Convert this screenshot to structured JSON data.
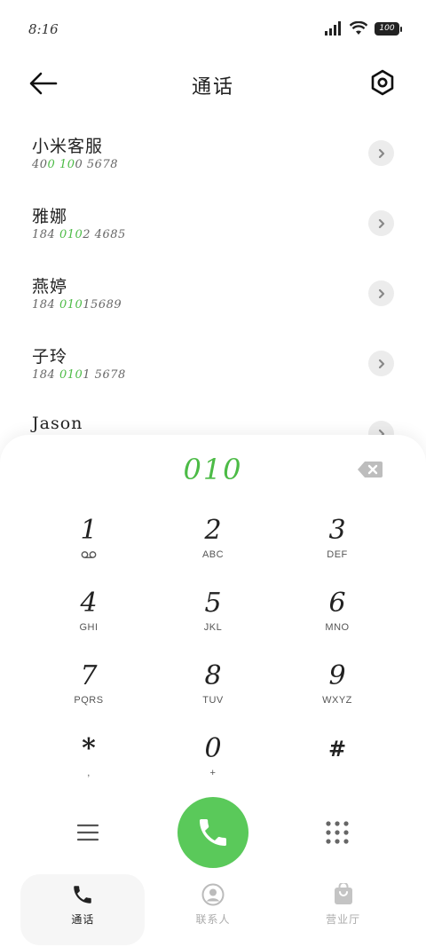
{
  "status_bar": {
    "time": "8:16",
    "battery": "100"
  },
  "header": {
    "title": "通话"
  },
  "contacts": [
    {
      "name": "小米客服",
      "number_pre": "40",
      "number_hl": "0 10",
      "number_post": "0 5678"
    },
    {
      "name": "雅娜",
      "number_pre": "184 ",
      "number_hl": "010",
      "number_post": "2 4685"
    },
    {
      "name": "燕婷",
      "number_pre": "184 ",
      "number_hl": "010",
      "number_post": "15689"
    },
    {
      "name": "子玲",
      "number_pre": "184 ",
      "number_hl": "010",
      "number_post": "1 5678"
    },
    {
      "name": "Jason",
      "number_pre": "",
      "number_hl": "",
      "number_post": ""
    }
  ],
  "dialer": {
    "input": "010",
    "keys": [
      {
        "digit": "1",
        "sub": ""
      },
      {
        "digit": "2",
        "sub": "ABC"
      },
      {
        "digit": "3",
        "sub": "DEF"
      },
      {
        "digit": "4",
        "sub": "GHI"
      },
      {
        "digit": "5",
        "sub": "JKL"
      },
      {
        "digit": "6",
        "sub": "MNO"
      },
      {
        "digit": "7",
        "sub": "PQRS"
      },
      {
        "digit": "8",
        "sub": "TUV"
      },
      {
        "digit": "9",
        "sub": "WXYZ"
      },
      {
        "digit": "*",
        "sub": ","
      },
      {
        "digit": "0",
        "sub": "+"
      },
      {
        "digit": "#",
        "sub": ""
      }
    ]
  },
  "bottom_nav": [
    {
      "label": "通话",
      "icon": "phone-icon",
      "active": true
    },
    {
      "label": "联系人",
      "icon": "contacts-icon",
      "active": false
    },
    {
      "label": "营业厅",
      "icon": "store-bag-icon",
      "active": false
    }
  ],
  "colors": {
    "accent": "#4cbb46",
    "call_button": "#5ac95a"
  }
}
